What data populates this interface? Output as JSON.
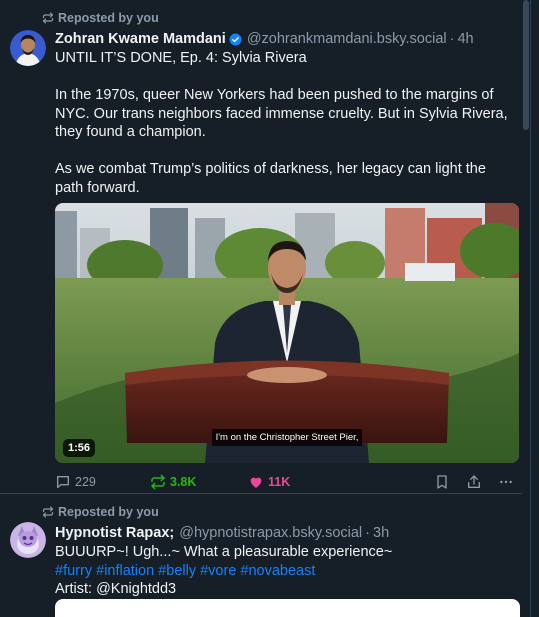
{
  "posts": [
    {
      "repost_label": "Reposted by you",
      "display_name": "Zohran Kwame Mamdani",
      "handle": "@zohrankmamdani.bsky.social",
      "separator": "·",
      "time": "4h",
      "verified": true,
      "text_lines": [
        "UNTIL IT’S DONE, Ep. 4: Sylvia Rivera",
        "In the 1970s, queer New Yorkers had been pushed to the margins of NYC. Our trans neighbors faced immense cruelty. But in Sylvia Rivera, they found a champion.",
        "As we combat Trump’s politics of darkness, her legacy can light the path forward."
      ],
      "video": {
        "duration": "1:56",
        "subtitle": "I'm on the Christopher Street Pier,"
      },
      "stats": {
        "replies": "229",
        "reposts": "3.8K",
        "likes": "11K"
      }
    },
    {
      "repost_label": "Reposted by you",
      "display_name": "Hypnotist Rapax;",
      "handle": "@hypnotistrapax.bsky.social",
      "separator": "·",
      "time": "3h",
      "text_line1": "BUUURP~! Ugh...~ What a pleasurable experience~",
      "hashtags": [
        "#furry",
        "#inflation",
        "#belly",
        "#vore",
        "#novabeast"
      ],
      "text_line3": "Artist: @Knightdd3"
    }
  ],
  "colors": {
    "background": "#161e27",
    "muted": "#8c9bab",
    "repost_green": "#20bc07",
    "like_pink": "#ec4899",
    "link_blue": "#1083fe",
    "verified_blue": "#1083fe"
  },
  "icons": [
    "repost-icon",
    "verified-icon",
    "reply-icon",
    "like-icon",
    "bookmark-icon",
    "share-icon",
    "more-icon",
    "play-icon"
  ]
}
